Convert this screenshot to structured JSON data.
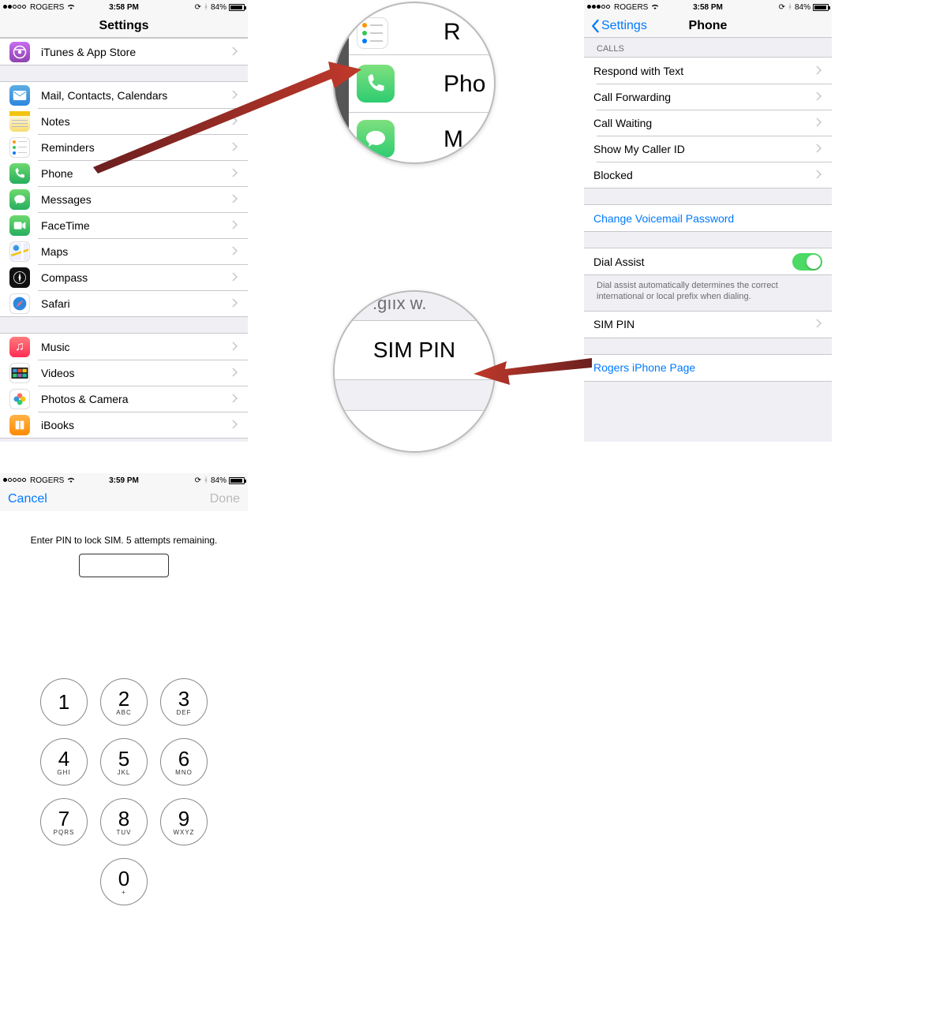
{
  "screen1": {
    "status": {
      "carrier": "ROGERS",
      "time": "3:58 PM",
      "battery": "84%"
    },
    "title": "Settings",
    "group0": [
      {
        "name": "itunes",
        "label": "iTunes & App Store",
        "icon": "ic-itunes",
        "iconName": "app-store-icon"
      }
    ],
    "group1": [
      {
        "name": "mail",
        "label": "Mail, Contacts, Calendars",
        "icon": "ic-mail",
        "iconName": "mail-icon"
      },
      {
        "name": "notes",
        "label": "Notes",
        "icon": "ic-notes",
        "iconName": "notes-icon"
      },
      {
        "name": "reminders",
        "label": "Reminders",
        "icon": "ic-reminders",
        "iconName": "reminders-icon"
      },
      {
        "name": "phone",
        "label": "Phone",
        "icon": "ic-phone",
        "iconName": "phone-icon"
      },
      {
        "name": "messages",
        "label": "Messages",
        "icon": "ic-messages",
        "iconName": "messages-icon"
      },
      {
        "name": "facetime",
        "label": "FaceTime",
        "icon": "ic-facetime",
        "iconName": "facetime-icon"
      },
      {
        "name": "maps",
        "label": "Maps",
        "icon": "ic-maps",
        "iconName": "maps-icon"
      },
      {
        "name": "compass",
        "label": "Compass",
        "icon": "ic-compass",
        "iconName": "compass-icon"
      },
      {
        "name": "safari",
        "label": "Safari",
        "icon": "ic-safari",
        "iconName": "safari-icon"
      }
    ],
    "group2": [
      {
        "name": "music",
        "label": "Music",
        "icon": "ic-music",
        "iconName": "music-icon"
      },
      {
        "name": "videos",
        "label": "Videos",
        "icon": "ic-videos",
        "iconName": "videos-icon"
      },
      {
        "name": "photos",
        "label": "Photos & Camera",
        "icon": "ic-photos",
        "iconName": "photos-icon"
      },
      {
        "name": "ibooks",
        "label": "iBooks",
        "icon": "ic-ibooks",
        "iconName": "ibooks-icon"
      }
    ]
  },
  "screen2": {
    "status": {
      "carrier": "ROGERS",
      "time": "3:58 PM",
      "battery": "84%"
    },
    "back": "Settings",
    "title": "Phone",
    "calls_header": "CALLS",
    "calls": [
      {
        "name": "respond",
        "label": "Respond with Text"
      },
      {
        "name": "forwarding",
        "label": "Call Forwarding"
      },
      {
        "name": "waiting",
        "label": "Call Waiting"
      },
      {
        "name": "callerid",
        "label": "Show My Caller ID"
      },
      {
        "name": "blocked",
        "label": "Blocked"
      }
    ],
    "voicemail": "Change Voicemail Password",
    "dialassist": "Dial Assist",
    "dialassist_text": "Dial assist automatically determines the correct international or local prefix when dialing.",
    "simpin": "SIM PIN",
    "carrier_page": "Rogers iPhone Page"
  },
  "screen3": {
    "status": {
      "carrier": "ROGERS",
      "time": "3:59 PM",
      "battery": "84%"
    },
    "cancel": "Cancel",
    "done": "Done",
    "prompt": "Enter PIN to lock SIM. 5 attempts remaining.",
    "keys": [
      {
        "n": "1",
        "l": ""
      },
      {
        "n": "2",
        "l": "ABC"
      },
      {
        "n": "3",
        "l": "DEF"
      },
      {
        "n": "4",
        "l": "GHI"
      },
      {
        "n": "5",
        "l": "JKL"
      },
      {
        "n": "6",
        "l": "MNO"
      },
      {
        "n": "7",
        "l": "PQRS"
      },
      {
        "n": "8",
        "l": "TUV"
      },
      {
        "n": "9",
        "l": "WXYZ"
      },
      {
        "n": "0",
        "l": "+"
      }
    ]
  },
  "mag1": {
    "text1": "R",
    "text2": "Pho",
    "text3": "M"
  },
  "mag2": {
    "text1": ".gııx w.",
    "text2": "SIM PIN"
  }
}
